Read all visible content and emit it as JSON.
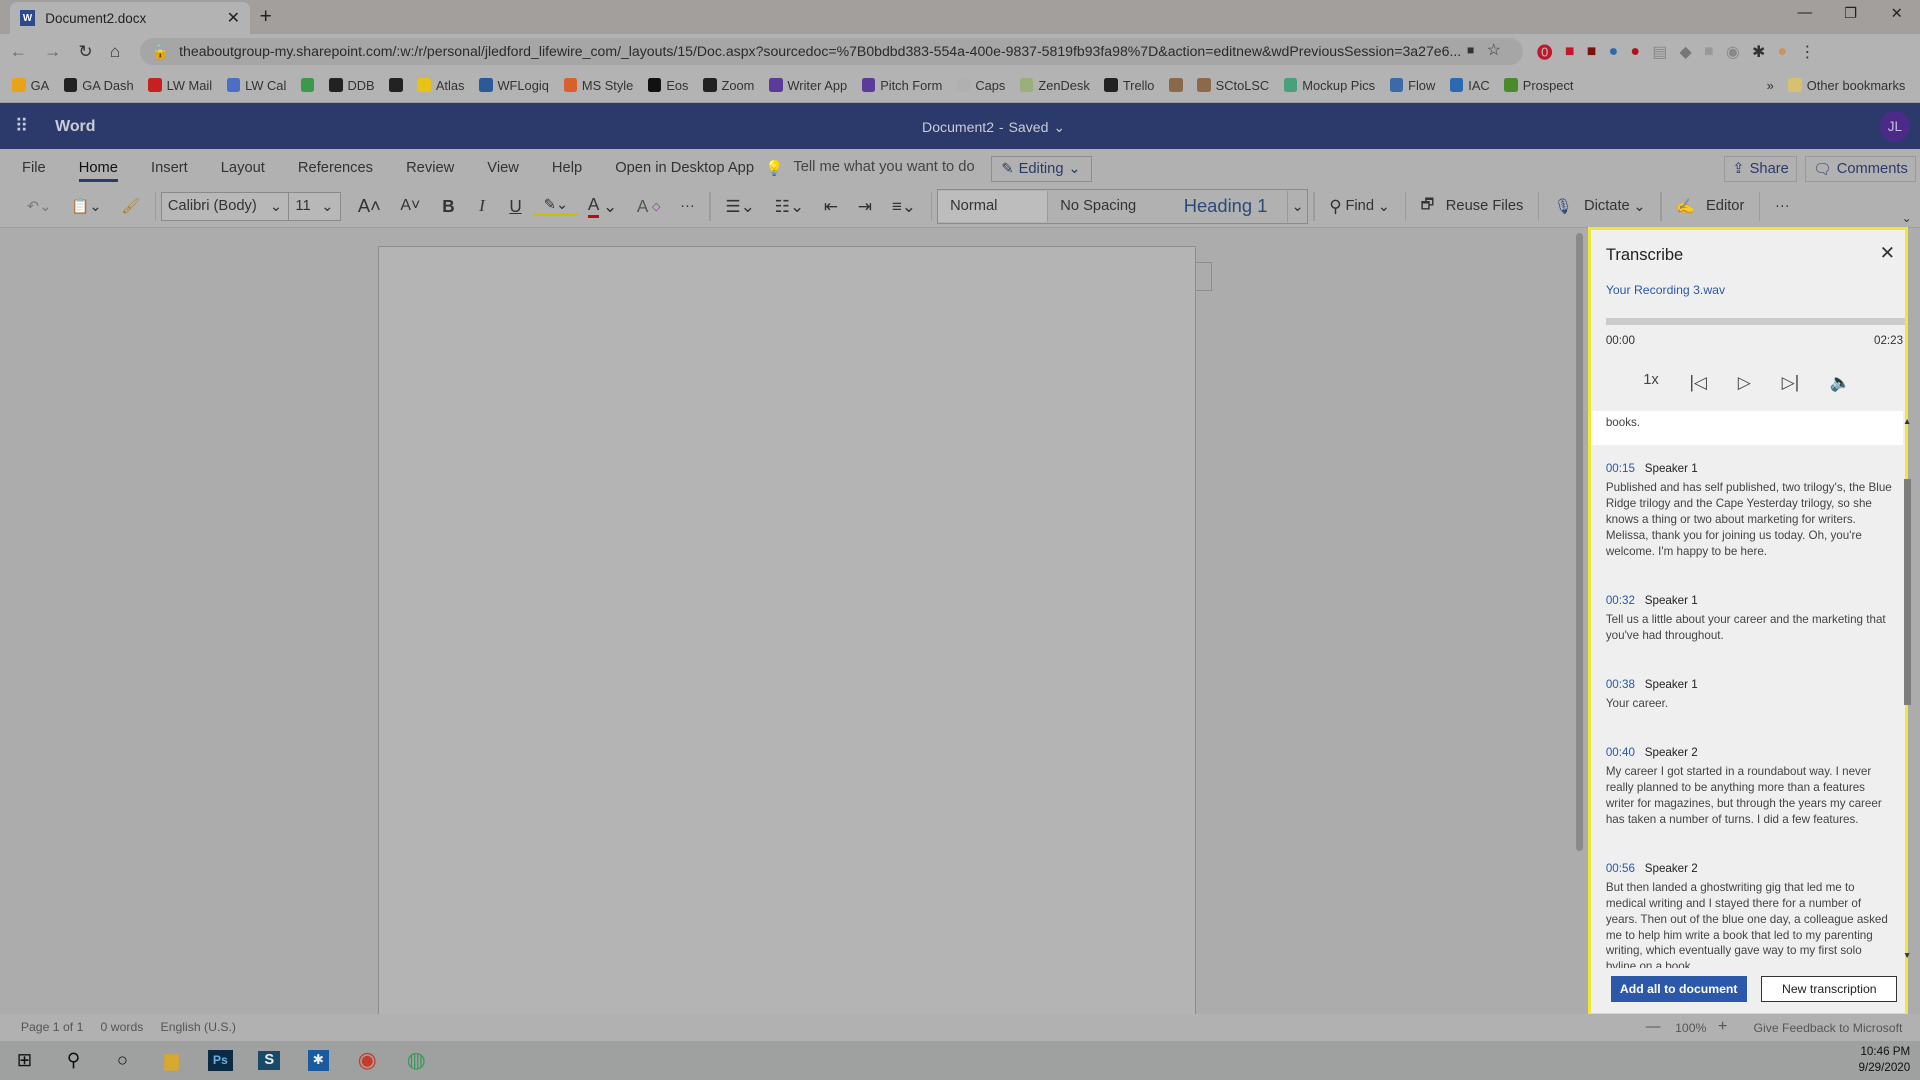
{
  "browser": {
    "tab_title": "Document2.docx",
    "url": "theaboutgroup-my.sharepoint.com/:w:/r/personal/jledford_lifewire_com/_layouts/15/Doc.aspx?sourcedoc=%7B0bdbd383-554a-400e-9837-5819fb93fa98%7D&action=editnew&wdPreviousSession=3a27e6...",
    "bookmarks": [
      {
        "label": "GA",
        "color": "#e8a317"
      },
      {
        "label": "GA Dash",
        "color": "#222222"
      },
      {
        "label": "LW Mail",
        "color": "#c5221f"
      },
      {
        "label": "LW Cal",
        "color": "#4a6fc4"
      },
      {
        "label": "",
        "color": "#3a9a4a"
      },
      {
        "label": "DDB",
        "color": "#222222"
      },
      {
        "label": "",
        "color": "#222222"
      },
      {
        "label": "Atlas",
        "color": "#e8c317"
      },
      {
        "label": "WFLogiq",
        "color": "#2a5a9a"
      },
      {
        "label": "MS Style",
        "color": "#d9602b"
      },
      {
        "label": "Eos",
        "color": "#111111"
      },
      {
        "label": "Zoom",
        "color": "#222222"
      },
      {
        "label": "Writer App",
        "color": "#5b3a9a"
      },
      {
        "label": "Pitch Form",
        "color": "#5b3a9a"
      },
      {
        "label": "Caps",
        "color": "#b0b0b0"
      },
      {
        "label": "ZenDesk",
        "color": "#9ab07a"
      },
      {
        "label": "Trello",
        "color": "#222222"
      },
      {
        "label": "",
        "color": "#8a6a4a"
      },
      {
        "label": "SCtoLSC",
        "color": "#8a6a4a"
      },
      {
        "label": "Mockup Pics",
        "color": "#4aa07a"
      },
      {
        "label": "Flow",
        "color": "#3a6aa8"
      },
      {
        "label": "IAC",
        "color": "#2a6ab0"
      },
      {
        "label": "Prospect",
        "color": "#4a8a2a"
      }
    ],
    "more_bookmarks": "»",
    "other_bookmarks": "Other bookmarks"
  },
  "app": {
    "name": "Word",
    "doc_title": "Document2",
    "doc_status": "Saved",
    "avatar_initials": "JL",
    "menu_tabs": [
      "File",
      "Home",
      "Insert",
      "Layout",
      "References",
      "Review",
      "View",
      "Help",
      "Open in Desktop App"
    ],
    "active_tab": "Home",
    "tell_me": "Tell me what you want to do",
    "editing": "Editing",
    "share": "Share",
    "comments": "Comments"
  },
  "ribbon": {
    "font": "Calibri (Body)",
    "size": "11",
    "styles": [
      "Normal",
      "No Spacing",
      "Heading 1"
    ],
    "find": "Find",
    "reuse_files": "Reuse Files",
    "dictate": "Dictate",
    "editor": "Editor",
    "more": "···"
  },
  "status": {
    "page": "Page 1 of 1",
    "words": "0 words",
    "language": "English (U.S.)",
    "zoom": "100%",
    "feedback": "Give Feedback to Microsoft"
  },
  "taskbar": {
    "time": "10:46 PM",
    "date": "9/29/2020"
  },
  "transcribe": {
    "title": "Transcribe",
    "file": "Your Recording 3.wav",
    "current_time": "00:00",
    "duration": "02:23",
    "progress_percent": 0,
    "speed": "1x",
    "prev_text": "books.",
    "segments": [
      {
        "time": "00:15",
        "speaker": "Speaker 1",
        "text": "Published and has self published, two trilogy's, the Blue Ridge trilogy and the Cape Yesterday trilogy, so she knows a thing or two about marketing for writers. Melissa, thank you for joining us today. Oh, you're welcome. I'm happy to be here."
      },
      {
        "time": "00:32",
        "speaker": "Speaker 1",
        "text": "Tell us a little about your career and the marketing that you've had throughout."
      },
      {
        "time": "00:38",
        "speaker": "Speaker 1",
        "text": "Your career."
      },
      {
        "time": "00:40",
        "speaker": "Speaker 2",
        "text": "My career I got started in a roundabout way. I never really planned to be anything more than a features writer for magazines, but through the years my career has taken a number of turns. I did a few features."
      },
      {
        "time": "00:56",
        "speaker": "Speaker 2",
        "text": "But then landed a ghostwriting gig that led me to medical writing and I stayed there for a number of years. Then out of the blue one day, a colleague asked me to help him write a book that led to my parenting writing, which eventually gave way to my first solo byline on a book."
      }
    ],
    "add_all": "Add all to document",
    "new_transcription": "New transcription",
    "highlight_color": "#f3e637",
    "accent_color": "#2b58a8"
  }
}
